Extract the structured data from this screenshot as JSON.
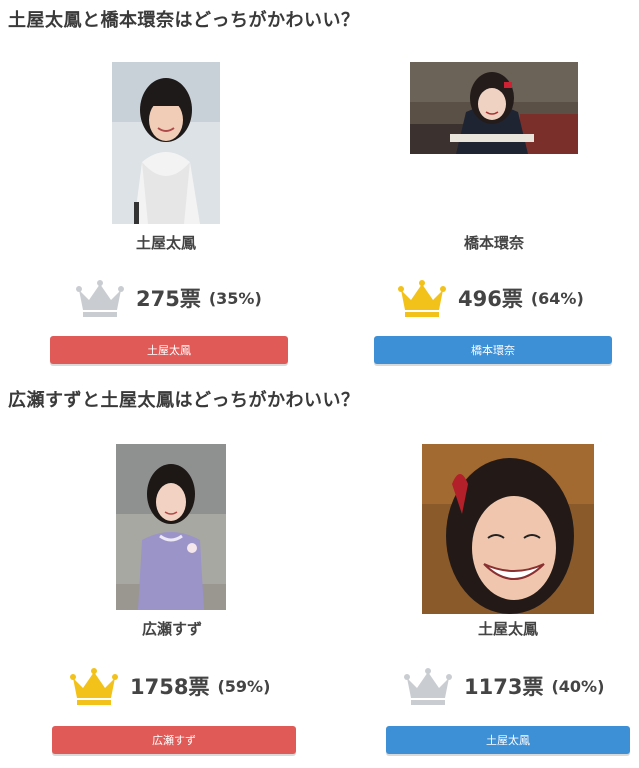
{
  "polls": [
    {
      "title": "土屋太鳳と橋本環奈はどっちがかわいい？",
      "left": {
        "name": "土屋太鳳",
        "votes": "275票",
        "percent": "(35%)",
        "button": "土屋太鳳",
        "crown": "silver-crown-icon"
      },
      "right": {
        "name": "橋本環奈",
        "votes": "496票",
        "percent": "(64%)",
        "button": "橋本環奈",
        "crown": "gold-crown-icon"
      }
    },
    {
      "title": "広瀬すずと土屋太鳳はどっちがかわいい？",
      "left": {
        "name": "広瀬すず",
        "votes": "1758票",
        "percent": "(59%)",
        "button": "広瀬すず",
        "crown": "gold-crown-icon"
      },
      "right": {
        "name": "土屋太鳳",
        "votes": "1173票",
        "percent": "(40%)",
        "button": "土屋太鳳",
        "crown": "silver-crown-icon"
      }
    }
  ],
  "colors": {
    "left_button": "#e05a57",
    "right_button": "#3d8fd6",
    "gold": "#f2c21a",
    "silver": "#c9cdd2"
  }
}
